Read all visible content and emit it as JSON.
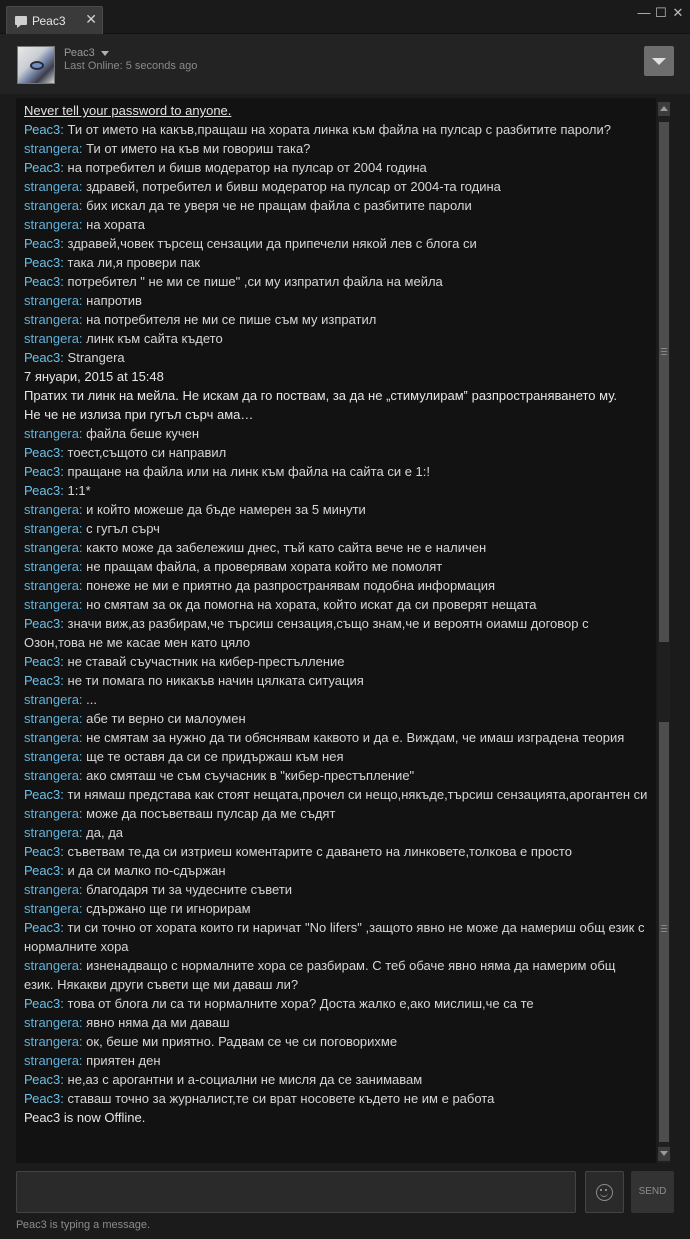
{
  "window": {
    "tab_title": "Реас3",
    "close_glyph": "✕",
    "minimize_glyph": "—",
    "maximize_glyph": "☐",
    "close_window_glyph": "✕"
  },
  "header": {
    "name": "Реас3",
    "status": "Last Online: 5 seconds ago"
  },
  "chat": {
    "warning": "Never tell your password to anyone.",
    "messages": [
      {
        "sender": "Реас3",
        "text": "Ти от името на какъв,пращаш на хората линка към файла на пулсар с разбитите пароли?"
      },
      {
        "sender": "strangera",
        "text": "Ти от името на къв ми говориш така?"
      },
      {
        "sender": "Реас3",
        "text": "на потребител и бишв модератор на пулсар от 2004 година"
      },
      {
        "sender": "strangera",
        "text": "здравей, потребител и бивш модератор на пулсар от 2004-та година"
      },
      {
        "sender": "strangera",
        "text": "бих искал да те уверя че не пращам файла с разбитите пароли"
      },
      {
        "sender": "strangera",
        "text": "на хората"
      },
      {
        "sender": "Реас3",
        "text": "здравей,човек търсещ сензации да припечели някой лев с блога си"
      },
      {
        "sender": "Реас3",
        "text": "така ли,я провери пак"
      },
      {
        "sender": "Реас3",
        "text": "потребител \" не ми се пише\" ,си му изпратил файла на мейла"
      },
      {
        "sender": "strangera",
        "text": "напротив"
      },
      {
        "sender": "strangera",
        "text": "на потребителя не ми се пише съм му изпратил"
      },
      {
        "sender": "strangera",
        "text": "линк към сайта където"
      },
      {
        "sender": "Реас3",
        "text": "Strangera"
      },
      {
        "sender": "",
        "text": "7 януари, 2015 at 15:48"
      },
      {
        "sender": "",
        "text": "Пратих ти линк на мейла. Не искам да го поствам, за да не „стимулирам‟ разпространяването му."
      },
      {
        "sender": "",
        "text": "Не че не излиза при гугъл сърч ама…"
      },
      {
        "sender": "strangera",
        "text": "файла беше кучен"
      },
      {
        "sender": "Реас3",
        "text": "тоест,същото си направил"
      },
      {
        "sender": "Реас3",
        "text": "пращане на файла или на линк към файла на сайта си е 1:!"
      },
      {
        "sender": "Реас3",
        "text": "1:1*"
      },
      {
        "sender": "strangera",
        "text": "и който можеше да бъде намерен за 5 минути"
      },
      {
        "sender": "strangera",
        "text": "с гугъл сърч"
      },
      {
        "sender": "strangera",
        "text": "както може да забележиш днес, тъй като сайта вече не е наличен"
      },
      {
        "sender": "strangera",
        "text": "не пращам файла, а проверявам хората който ме помолят"
      },
      {
        "sender": "strangera",
        "text": "понеже не ми е приятно да разпространявам подобна информация"
      },
      {
        "sender": "strangera",
        "text": "но смятам за ок да помогна на хората, който искат да си проверят нещата"
      },
      {
        "sender": "Реас3",
        "text": "значи виж,аз разбирам,че търсиш сензация,също знам,че и вероятн оиамш договор с Озон,това не ме касае мен като цяло"
      },
      {
        "sender": "Реас3",
        "text": "не ставай съучастник на кибер-престълление"
      },
      {
        "sender": "Реас3",
        "text": "не ти помага по никакъв начин цялката ситуация"
      },
      {
        "sender": "strangera",
        "text": "..."
      },
      {
        "sender": "strangera",
        "text": "абе ти верно си малоумен"
      },
      {
        "sender": "strangera",
        "text": "не смятам за нужно да ти обяснявам каквото и да е. Виждам, че имаш изградена теория"
      },
      {
        "sender": "strangera",
        "text": "ще те оставя да си се придържаш към нея"
      },
      {
        "sender": "strangera",
        "text": "ако смяташ че съм съучасник в \"кибер-престъпление\""
      },
      {
        "sender": "Реас3",
        "text": "ти нямаш представа как стоят нещата,прочел си нещо,някъде,търсиш сензацията,арогантен си"
      },
      {
        "sender": "strangera",
        "text": "може да посъветваш пулсар да ме съдят"
      },
      {
        "sender": "strangera",
        "text": "да, да"
      },
      {
        "sender": "Реас3",
        "text": "съветвам те,да си изтриеш коментарите с даването на линковете,толкова е просто"
      },
      {
        "sender": "Реас3",
        "text": "и да си малко по-сдържан"
      },
      {
        "sender": "strangera",
        "text": "благодаря ти за чудесните съвети"
      },
      {
        "sender": "strangera",
        "text": "сдържано ще ги игнорирам"
      },
      {
        "sender": "Реас3",
        "text": "ти си точно от хората които ги наричат \"No lifers\" ,защото явно не може да намериш общ език с нормалните хора"
      },
      {
        "sender": "strangera",
        "text": "изненадващо с нормалните хора се разбирам. С теб обаче явно няма да намерим общ език. Някакви други съвети ще ми даваш ли?"
      },
      {
        "sender": "Реас3",
        "text": "това от блога ли са ти нормалните хора? Доста жалко е,ако мислиш,че са те"
      },
      {
        "sender": "strangera",
        "text": "явно няма да ми даваш"
      },
      {
        "sender": "strangera",
        "text": "ок, беше ми приятно. Радвам се че си поговорихме"
      },
      {
        "sender": "strangera",
        "text": "приятен ден"
      },
      {
        "sender": "Реас3",
        "text": "не,аз с арогантни и а-социални не мисля да се занимавам"
      },
      {
        "sender": "Реас3",
        "text": "ставаш точно за журналист,те си врат носовете където не им е работа"
      },
      {
        "sender": "",
        "text": "Реас3 is now Offline."
      }
    ]
  },
  "compose": {
    "placeholder": "",
    "send_label": "SEND",
    "typing_status": "Реас3 is typing a message."
  },
  "colors": {
    "background": "#1b1b1c",
    "chat_background": "#121213",
    "sender_name": "#6fbfe6",
    "message_text": "#d6d6d6"
  },
  "icons": [
    "chat-bubble-icon",
    "close-icon",
    "minimize-icon",
    "maximize-icon",
    "chevron-down-icon",
    "emoticon-icon"
  ]
}
